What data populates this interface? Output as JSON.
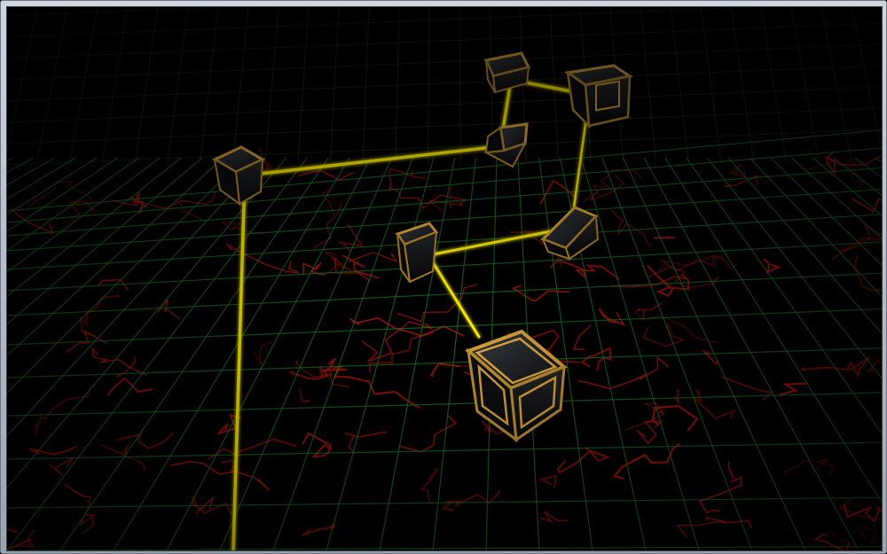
{
  "scene": {
    "type": "3d-laser-puzzle-view",
    "background_color": "#000000",
    "grid_color": "#1f7a2a",
    "floor_crack_color": "#c21a0d",
    "laser_color": "#ffee00",
    "block_trim_color": "#d8a23a",
    "block_face_color": "#15171a",
    "blocks": [
      {
        "id": "mirror-block-top-center",
        "kind": "mirror"
      },
      {
        "id": "mirror-block-top-right",
        "kind": "mirror"
      },
      {
        "id": "mirror-block-left",
        "kind": "mirror"
      },
      {
        "id": "mirror-block-mid-upper",
        "kind": "mirror"
      },
      {
        "id": "mirror-block-center",
        "kind": "mirror"
      },
      {
        "id": "mirror-block-right",
        "kind": "mirror"
      },
      {
        "id": "selected-player-cube",
        "kind": "cube"
      }
    ]
  }
}
